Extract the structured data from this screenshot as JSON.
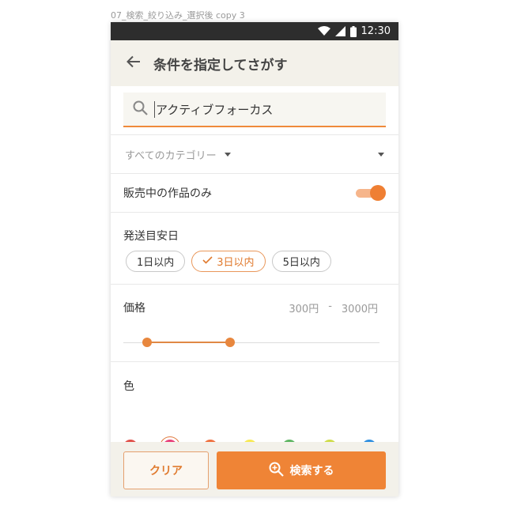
{
  "artboard_label": "07_検索_絞り込み_選択後 copy 3",
  "status_bar": {
    "time": "12:30",
    "icons": [
      "wifi-icon",
      "signal-icon",
      "battery-icon"
    ]
  },
  "app_bar": {
    "title": "条件を指定してさがす",
    "back_icon": "arrow-left-icon"
  },
  "search": {
    "value": "アクティブフォーカス",
    "icon": "search-icon"
  },
  "category": {
    "selected": "すべてのカテゴリー"
  },
  "on_sale": {
    "label": "販売中の作品のみ",
    "enabled": true
  },
  "shipping": {
    "label": "発送目安日",
    "options": [
      {
        "label": "1日以内",
        "selected": false
      },
      {
        "label": "3日以内",
        "selected": true
      },
      {
        "label": "5日以内",
        "selected": false
      }
    ]
  },
  "price": {
    "label": "価格",
    "min": "300円",
    "separator": "-",
    "max": "3000円"
  },
  "color": {
    "label": "色",
    "swatches": [
      {
        "hex": "#e0504a",
        "selected": false
      },
      {
        "hex": "#e8407a",
        "selected": true
      },
      {
        "hex": "#ef7140",
        "selected": false
      },
      {
        "hex": "#f7e954",
        "selected": false
      },
      {
        "hex": "#5eb562",
        "selected": false
      },
      {
        "hex": "#cfdc4a",
        "selected": false
      },
      {
        "hex": "#2f8fe0",
        "selected": false
      },
      {
        "hex": "#32b3ea",
        "selected": false
      },
      {
        "hex": "#7b4fc2",
        "selected": false
      },
      {
        "hex": "#4e4e4e",
        "selected": false
      },
      {
        "hex": "#9c9c9c",
        "selected": false
      },
      {
        "hex": "#ffffff",
        "selected": false
      }
    ]
  },
  "actions": {
    "clear_label": "クリア",
    "search_label": "検索する",
    "search_icon": "zoom-in-icon"
  },
  "colors": {
    "accent": "#ef8436",
    "appbar_bg": "#f3f1ea",
    "status_bar_bg": "#2d2d2d"
  }
}
